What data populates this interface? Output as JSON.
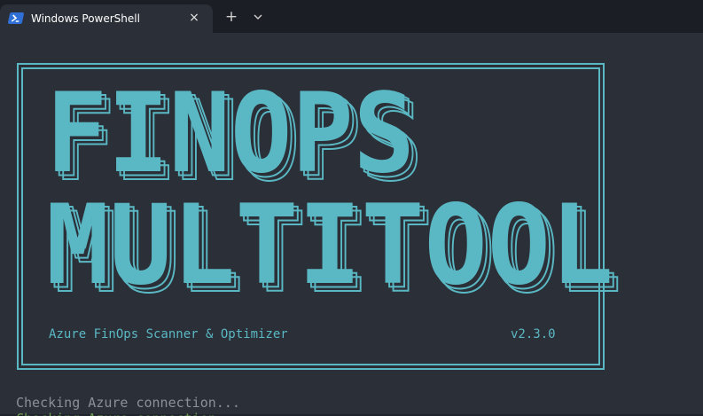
{
  "window": {
    "tab_title": "Windows PowerShell",
    "close_glyph": "×",
    "new_tab_glyph": "+"
  },
  "banner": {
    "line1": "FINOPS",
    "line2": "MULTITOOL",
    "subtitle": "Azure FinOps Scanner & Optimizer",
    "version": "v2.3.0"
  },
  "output": {
    "line1": "Checking Azure connection...",
    "line2": "Checking Azure connection..."
  },
  "colors": {
    "banner": "#5ab8c4",
    "background": "#2b2f37",
    "status_text": "#8a8f99"
  },
  "icons": {
    "tab": "powershell-icon",
    "close": "close-icon",
    "new_tab": "plus-icon",
    "dropdown": "chevron-down-icon"
  }
}
